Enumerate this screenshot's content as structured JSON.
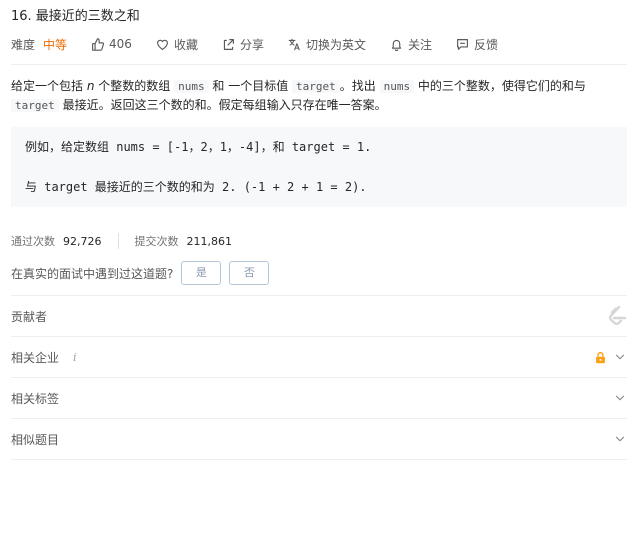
{
  "problem": {
    "title": "16. 最接近的三数之和",
    "difficulty_label": "难度",
    "difficulty": "中等"
  },
  "actions": {
    "likes": "406",
    "favorite": "收藏",
    "share": "分享",
    "switch_lang": "切换为英文",
    "follow": "关注",
    "feedback": "反馈"
  },
  "description": {
    "p1_a": "给定一个包括 ",
    "p1_n": "n",
    "p1_b": " 个整数的数组 ",
    "nums1": "nums",
    "p1_c": " 和 一个目标值 ",
    "target1": "target",
    "p1_d": "。找出 ",
    "nums2": "nums",
    "p1_e": " 中的三个整数，使得它们的和与 ",
    "target2": "target",
    "p1_f": " 最接近。返回这三个数的和。假定每组输入只存在唯一答案。"
  },
  "example": {
    "line1": "例如，给定数组 nums = [-1，2，1，-4]，和 target = 1.",
    "line2": "与 target 最接近的三个数的和为 2. (-1 + 2 + 1 = 2)."
  },
  "stats": {
    "accepted_label": "通过次数",
    "accepted": "92,726",
    "submissions_label": "提交次数",
    "submissions": "211,861"
  },
  "interview": {
    "question": "在真实的面试中遇到过这道题?",
    "yes": "是",
    "no": "否"
  },
  "sections": {
    "contributors": "贡献者",
    "companies": "相关企业",
    "companies_info": "i",
    "tags": "相关标签",
    "similar": "相似题目"
  },
  "colors": {
    "difficulty_medium": "#ef6c00",
    "lock": "#ffa116"
  }
}
